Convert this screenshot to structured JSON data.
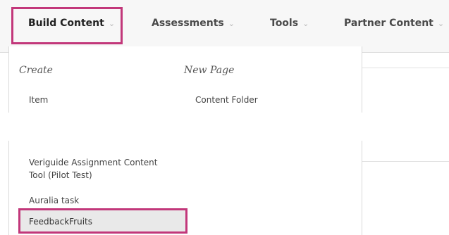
{
  "toolbar": {
    "items": [
      {
        "label": "Build Content",
        "chevron": "⌄"
      },
      {
        "label": "Assessments",
        "chevron": "⌄"
      },
      {
        "label": "Tools",
        "chevron": "⌄"
      },
      {
        "label": "Partner Content",
        "chevron": "⌄"
      }
    ]
  },
  "dropdown": {
    "create_heading": "Create",
    "new_page_heading": "New Page",
    "item_label": "Item",
    "content_folder_label": "Content Folder",
    "veriguide_line1": "Veriguide Assignment Content",
    "veriguide_line2": "Tool (Pilot Test)",
    "auralia_label": "Auralia task",
    "feedbackfruits_label": "FeedbackFruits"
  },
  "colors": {
    "highlight": "#c2377a",
    "toolbar_bg": "#f7f7f7",
    "selected_row_bg": "#e9e9e9"
  }
}
